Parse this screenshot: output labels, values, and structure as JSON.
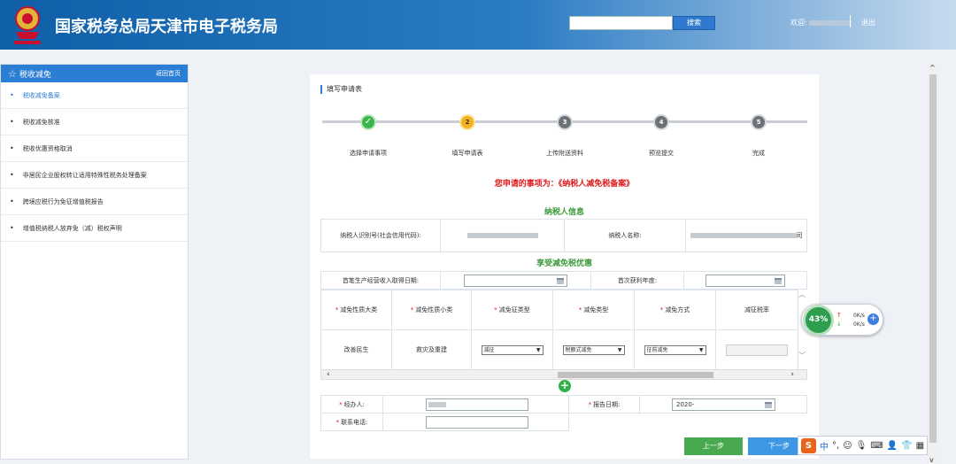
{
  "header": {
    "site_title": "国家税务总局天津市电子税务局",
    "search_button": "搜索",
    "welcome": "欢迎",
    "logout": "退出"
  },
  "sidebar": {
    "title": "税收减免",
    "home_link": "返回首页",
    "items": [
      {
        "label": "税收减免备案"
      },
      {
        "label": "税收减免核准"
      },
      {
        "label": "税收优惠资格取消"
      },
      {
        "label": "非居民企业股权转让适用特殊性税务处理备案"
      },
      {
        "label": "跨境应税行为免征增值税报告"
      },
      {
        "label": "增值税纳税人放弃免（减）税权声明"
      }
    ]
  },
  "form": {
    "section_title": "填写申请表",
    "steps": [
      {
        "num": "✓",
        "label": "选择申请事项"
      },
      {
        "num": "2",
        "label": "填写申请表"
      },
      {
        "num": "3",
        "label": "上传附送资料"
      },
      {
        "num": "4",
        "label": "预览提交"
      },
      {
        "num": "5",
        "label": "完成"
      }
    ],
    "notice": "您申请的事项为：《纳税人减免税备案》",
    "taxpayer_header": "纳税人信息",
    "taxpayer_id_label": "纳税人识别号(社会信用代码):",
    "taxpayer_name_label": "纳税人名称:",
    "taxpayer_name_suffix": "司",
    "benefit_header": "享受减免税优惠",
    "first_income_date_label": "首笔生产经营收入取得日期:",
    "first_profit_year_label": "首次获利年度:",
    "table_headers": [
      "减免性质大类",
      "减免性质小类",
      "减免征类型",
      "减免类型",
      "减免方式",
      "减征税率"
    ],
    "row": {
      "major": "改善民生",
      "minor": "救灾及重建",
      "type": "减征",
      "reduction_type": "税额式减免",
      "method": "征前减免"
    },
    "handler_label": "经办人:",
    "report_date_label": "报告日期:",
    "report_date_value": "2020-",
    "phone_label": "联系电话:",
    "prev_button": "上一步",
    "next_button": "下一步"
  },
  "monitor": {
    "percent": "43%",
    "up_speed": "0K/s",
    "down_speed": "0K/s"
  },
  "ime": {
    "logo": "S",
    "mode": "中"
  }
}
